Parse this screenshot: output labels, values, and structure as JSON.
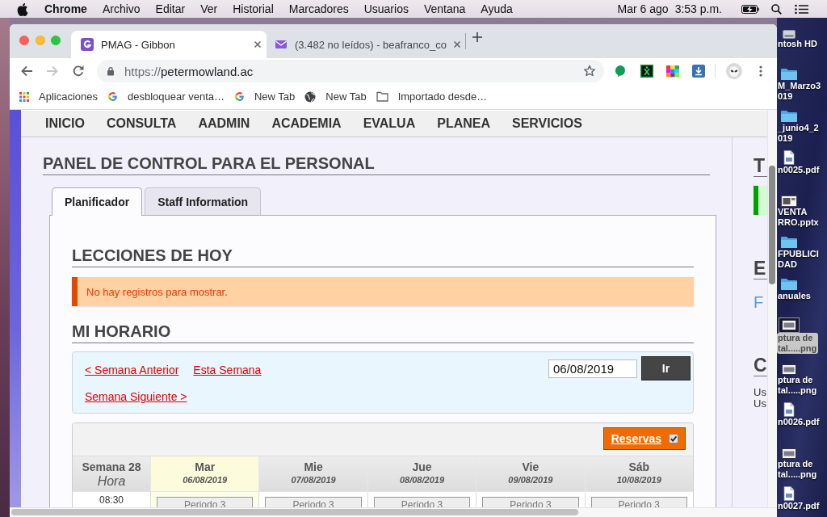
{
  "menu_bar": {
    "app": "Chrome",
    "menus": [
      "Archivo",
      "Editar",
      "Ver",
      "Historial",
      "Marcadores",
      "Usuarios",
      "Ventana",
      "Ayuda"
    ],
    "date": "Mar 6 ago",
    "time": "3:53 p.m."
  },
  "browser": {
    "tabs": [
      {
        "kind": "site",
        "title": "PMAG - Gibbon",
        "selected": true
      },
      {
        "kind": "mail",
        "title": "(3.482 no leídos) - beafranco_co",
        "selected": false
      }
    ],
    "nav_buttons": [
      {
        "kind": "back",
        "disabled": false
      },
      {
        "kind": "forward",
        "disabled": true
      },
      {
        "kind": "reload",
        "disabled": false
      }
    ],
    "address": {
      "scheme": "https://",
      "host": "petermowland.ac"
    },
    "bookmarks": [
      {
        "kind": "apps",
        "label": "Aplicaciones"
      },
      {
        "kind": "g",
        "label": "desbloquear venta…"
      },
      {
        "kind": "g",
        "label": "New Tab"
      },
      {
        "kind": "globe",
        "label": "New Tab"
      },
      {
        "kind": "folder",
        "label": "Importado desde…"
      }
    ]
  },
  "page": {
    "nav": [
      "INICIO",
      "CONSULTA",
      "AADMIN",
      "ACADEMIA",
      "EVALUA",
      "PLANEA",
      "SERVICIOS"
    ],
    "title": "PANEL DE CONTROL PARA EL PERSONAL",
    "tabs": [
      {
        "label": "Planificador",
        "selected": true
      },
      {
        "label": "Staff Information",
        "selected": false
      }
    ],
    "lessons": {
      "heading": "LECCIONES DE HOY",
      "message": "No hay registros para mostrar."
    },
    "schedule": {
      "heading": "MI HORARIO",
      "links": [
        "< Semana Anterior",
        "Esta Semana",
        "Semana Siguiente >"
      ],
      "date_field": {
        "value": "06/08/2019"
      },
      "go_button": "Ir",
      "bookings": {
        "label": "Reservas",
        "checked": true
      },
      "week": "Semana 28",
      "time_heading": "Hora",
      "days": [
        {
          "name": "Mar",
          "date": "06/08/2019",
          "today": true
        },
        {
          "name": "Mie",
          "date": "07/08/2019",
          "today": false
        },
        {
          "name": "Jue",
          "date": "08/08/2019",
          "today": false
        },
        {
          "name": "Vie",
          "date": "09/08/2019",
          "today": false
        },
        {
          "name": "Sáb",
          "date": "10/08/2019",
          "today": false
        }
      ],
      "rows": [
        {
          "time": "08:30",
          "cells": [
            "Periodo 3",
            "Periodo 3",
            "Periodo 3",
            "Periodo 3",
            "Periodo 3"
          ]
        }
      ]
    },
    "sidebar": [
      {
        "heading": "T",
        "kind": "notice"
      },
      {
        "heading": "E",
        "kind": "links",
        "items": [
          "F"
        ]
      },
      {
        "heading": "C",
        "kind": "text",
        "lines": [
          "Us",
          "Us"
        ]
      }
    ]
  },
  "desktop": {
    "icons": [
      {
        "kind": "disk",
        "lines": [
          "ntosh HD"
        ],
        "selected": false
      },
      {
        "kind": "folder",
        "lines": [
          "M_Marzo3",
          "019"
        ],
        "selected": false
      },
      {
        "kind": "folder",
        "lines": [
          "_junio4_2",
          "019"
        ],
        "selected": false
      },
      {
        "kind": "pdf",
        "lines": [
          "n0025.pdf"
        ],
        "selected": false
      },
      {
        "kind": "slides",
        "lines": [
          "VENTA",
          "RRO.pptx"
        ],
        "selected": false
      },
      {
        "kind": "folder",
        "lines": [
          "FPUBLICI",
          "DAD"
        ],
        "selected": false
      },
      {
        "kind": "folder",
        "lines": [
          "anuales"
        ],
        "selected": false
      },
      {
        "kind": "image",
        "lines": [
          "ptura de",
          "tal.....png"
        ],
        "selected": true
      },
      {
        "kind": "image",
        "lines": [
          "ptura de",
          "tal.....png"
        ],
        "selected": false
      },
      {
        "kind": "pdf",
        "lines": [
          "n0026.pdf"
        ],
        "selected": false
      },
      {
        "kind": "image",
        "lines": [
          "ptura de",
          "tal.....png"
        ],
        "selected": false
      },
      {
        "kind": "pdf",
        "lines": [
          "n0027.pdf"
        ],
        "selected": false
      }
    ]
  }
}
